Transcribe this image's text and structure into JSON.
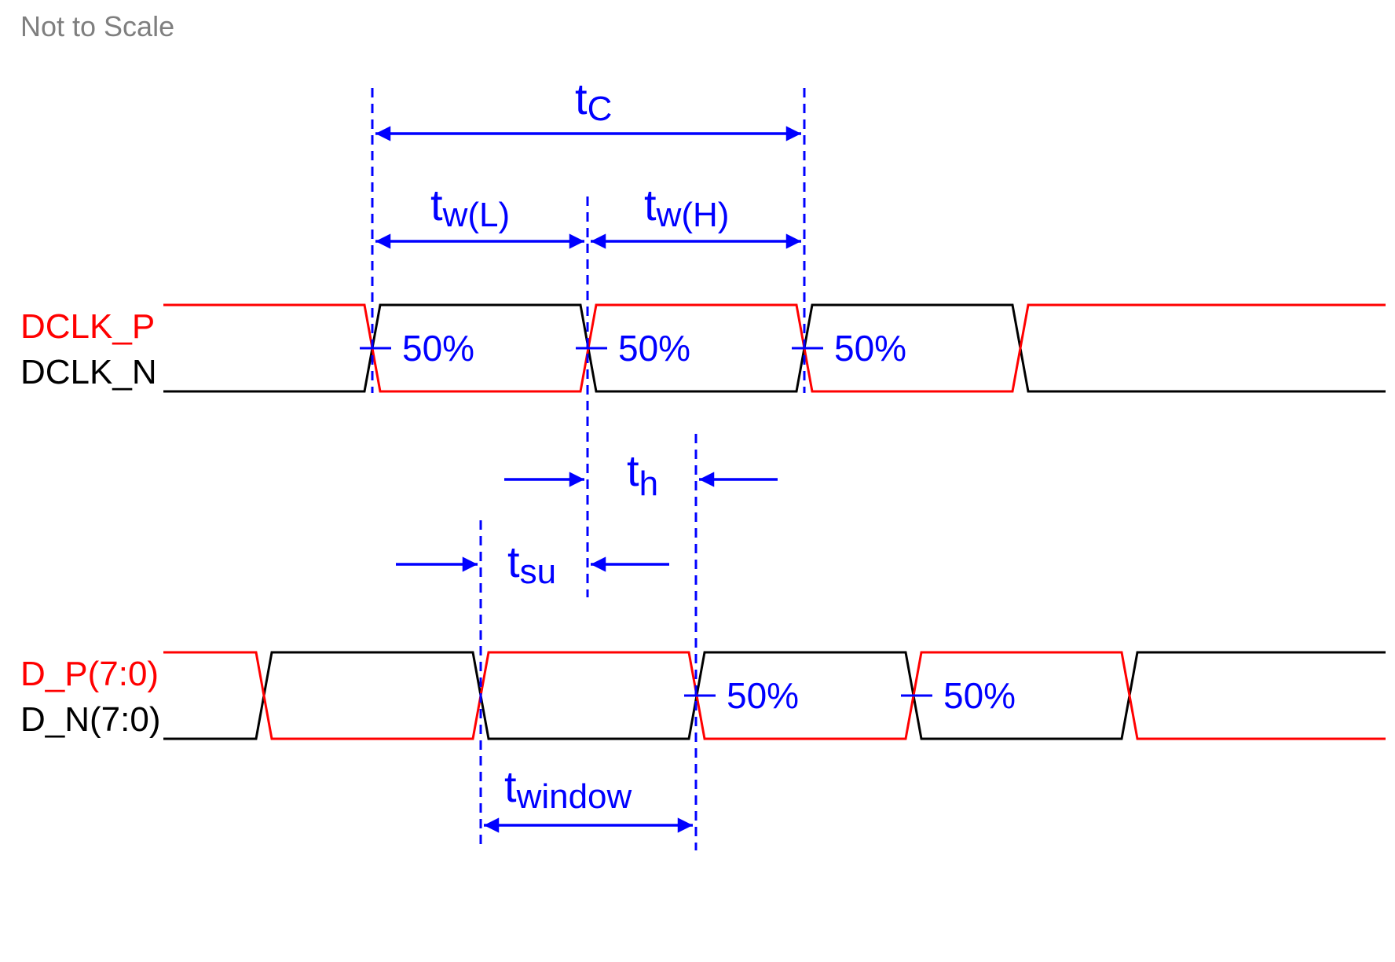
{
  "note": "Not to Scale",
  "colors": {
    "positive": "#ff0000",
    "negative": "#000000",
    "annotation": "#0000ff",
    "note": "#7f7f7f"
  },
  "signals": {
    "clock": {
      "positive_label": "DCLK_P",
      "negative_label": "DCLK_N",
      "initial_positive_state": "high",
      "transitions": 4
    },
    "data": {
      "positive_label": "D_P(7:0)",
      "negative_label": "D_N(7:0)",
      "initial_positive_state": "high",
      "transitions": 5
    }
  },
  "crossing_markers": {
    "clock": [
      "50%",
      "50%",
      "50%"
    ],
    "data": [
      "50%",
      "50%"
    ]
  },
  "timing": {
    "tc": {
      "main": "t",
      "sub": "C"
    },
    "tw_low": {
      "main": "t",
      "sub": "w(L)"
    },
    "tw_high": {
      "main": "t",
      "sub": "w(H)"
    },
    "th": {
      "main": "t",
      "sub": "h"
    },
    "tsu": {
      "main": "t",
      "sub": "su"
    },
    "twindow": {
      "main": "t",
      "sub": "window"
    }
  }
}
